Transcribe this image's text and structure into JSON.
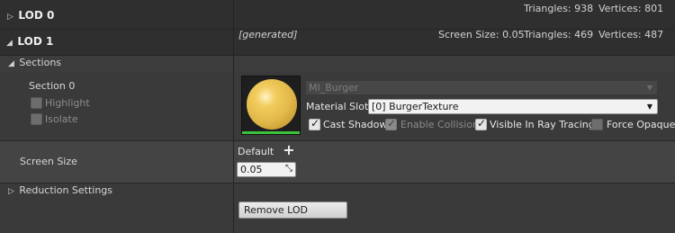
{
  "lod0": {
    "title": "LOD 0",
    "triangles": "Triangles: 938",
    "vertices": "Vertices: 801"
  },
  "lod1": {
    "title": "LOD 1",
    "generated": "[generated]",
    "screen_size": "Screen Size: 0.05",
    "triangles": "Triangles: 469",
    "vertices": "Vertices: 487"
  },
  "sections": {
    "title": "Sections",
    "section_label": "Section 0",
    "highlight": "Highlight",
    "isolate": "Isolate",
    "material_name": "MI_Burger",
    "material_slot_label": "Material Slot",
    "material_slot_value": "[0] BurgerTexture",
    "cast_shadow": "Cast Shadow",
    "enable_collision": "Enable Collision",
    "visible_in_ray_tracing": "Visible In Ray Tracing",
    "force_opaque": "Force Opaque"
  },
  "screen_size": {
    "label": "Screen Size",
    "platform": "Default",
    "value": "0.05"
  },
  "reduction": {
    "label": "Reduction Settings"
  },
  "remove_lod": "Remove LOD",
  "colors": {
    "background": "#383838",
    "header_bg": "#2f2f2f",
    "thumbnail_sphere": "#e2b84a",
    "thumbnail_underline": "#3cc13c"
  }
}
